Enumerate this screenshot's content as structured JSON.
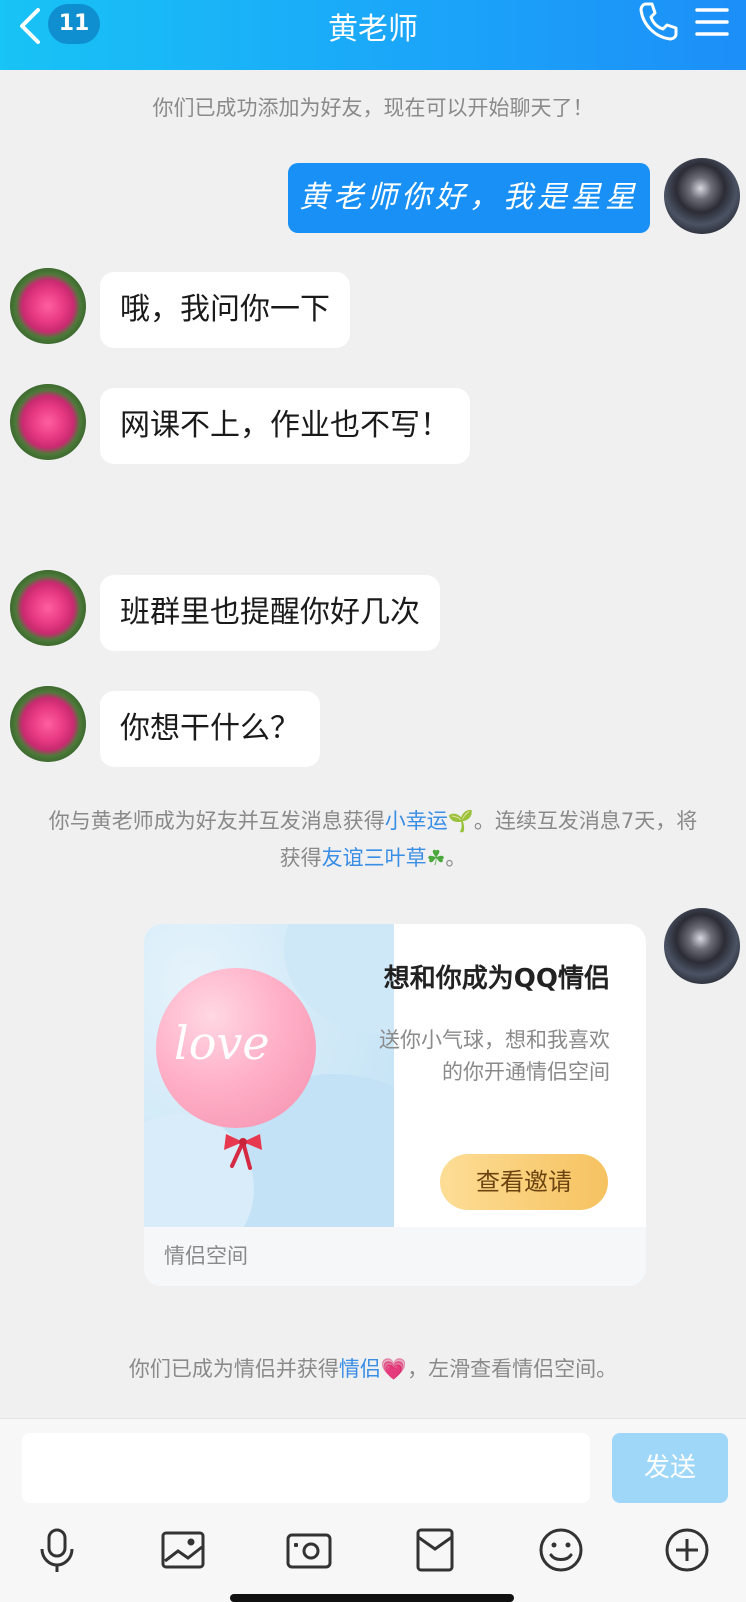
{
  "header": {
    "unread_count": "11",
    "title": "黄老师"
  },
  "messages": {
    "system_added": "你们已成功添加为好友，现在可以开始聊天了！",
    "me_1": "黄老师你好，我是星星",
    "teacher_1": "哦，我问你一下",
    "teacher_2": "网课不上，作业也不写！",
    "teacher_3": "班群里也提醒你好几次",
    "teacher_4": "你想干什么？",
    "system_luck": {
      "part1": "你与黄老师成为好友并互发消息获得",
      "link1": "小幸运",
      "emoji1": "🌱",
      "part2": "。连续互发消息7天，将获得",
      "link2": "友谊三叶草",
      "emoji2": "☘",
      "part3": "。"
    },
    "system_couple": {
      "part1": "你们已成为情侣并获得",
      "link": "情侣",
      "emoji": "💗",
      "part2": "，左滑查看情侣空间。"
    }
  },
  "invite_card": {
    "title": "想和你成为QQ情侣",
    "desc": "送你小气球，想和我喜欢的你开通情侣空间",
    "balloon_text": "love",
    "button": "查看邀请",
    "footer": "情侣空间"
  },
  "input_bar": {
    "send": "发送",
    "tools": [
      "microphone-icon",
      "image-icon",
      "camera-icon",
      "red-packet-icon",
      "emoji-icon",
      "plus-icon"
    ]
  },
  "colors": {
    "header_start": "#18c3f5",
    "header_end": "#1c8ff8",
    "my_bubble": "#1890f5",
    "link": "#3a8ee6",
    "send_disabled": "#9fd7f9"
  }
}
